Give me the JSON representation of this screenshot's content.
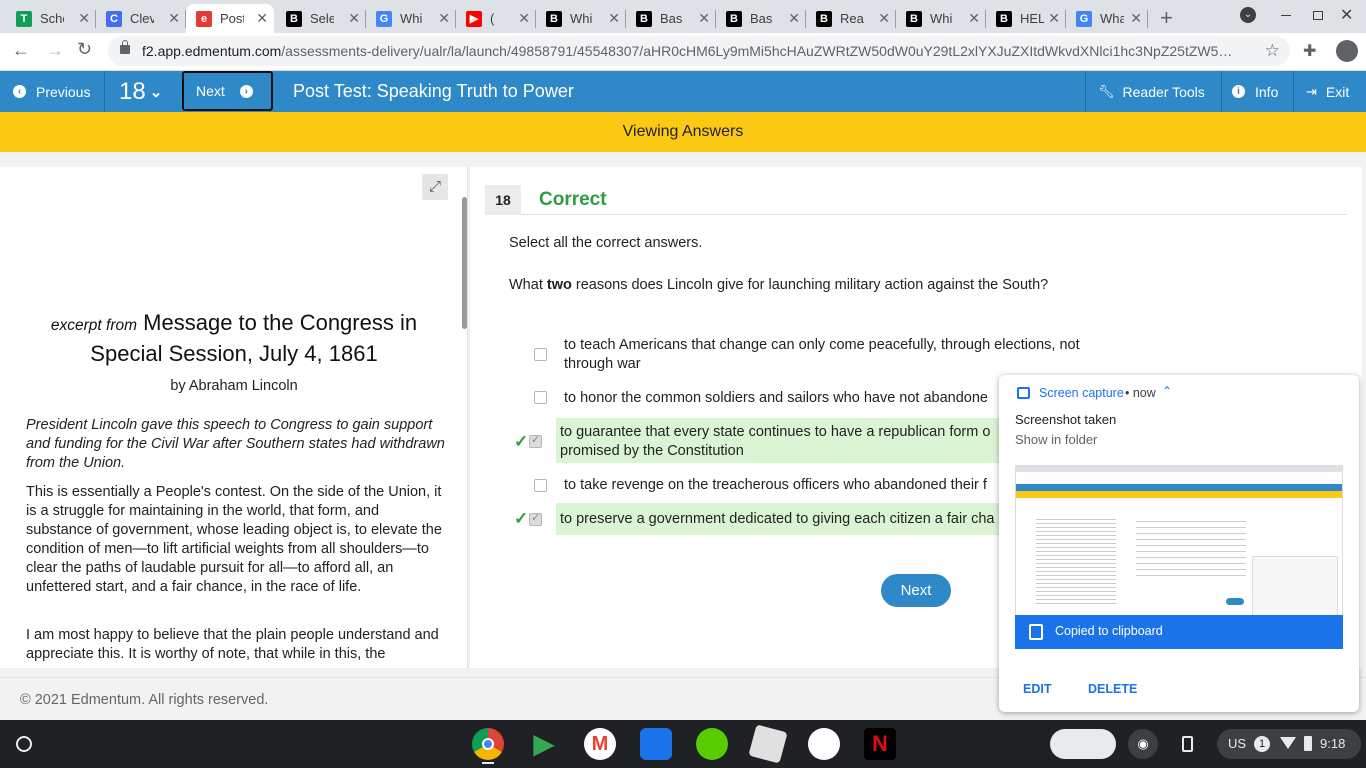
{
  "browser": {
    "tabs": [
      {
        "title": "Sche",
        "icon": "google-sheets-icon",
        "color": "#0f9d58",
        "glyph": "T"
      },
      {
        "title": "Clev",
        "icon": "clever-icon",
        "color": "#436cf2",
        "glyph": "C"
      },
      {
        "title": "Post",
        "icon": "edmentum-icon",
        "color": "#e53935",
        "glyph": "e",
        "active": true
      },
      {
        "title": "Sele",
        "icon": "brainly-icon",
        "color": "#000000",
        "glyph": "B"
      },
      {
        "title": "Whi",
        "icon": "google-icon",
        "color": "#4285f4",
        "glyph": "G"
      },
      {
        "title": "(",
        "icon": "youtube-icon",
        "color": "#ff0000",
        "glyph": "▶"
      },
      {
        "title": "Whi",
        "icon": "brainly-icon",
        "color": "#000000",
        "glyph": "B"
      },
      {
        "title": "Bas",
        "icon": "brainly-icon",
        "color": "#000000",
        "glyph": "B"
      },
      {
        "title": "Bas",
        "icon": "brainly-icon",
        "color": "#000000",
        "glyph": "B"
      },
      {
        "title": "Rea",
        "icon": "brainly-icon",
        "color": "#000000",
        "glyph": "B"
      },
      {
        "title": "Whi",
        "icon": "brainly-icon",
        "color": "#000000",
        "glyph": "B"
      },
      {
        "title": "HEL",
        "icon": "brainly-icon",
        "color": "#000000",
        "glyph": "B"
      },
      {
        "title": "Wha",
        "icon": "google-icon",
        "color": "#4285f4",
        "glyph": "G"
      }
    ],
    "url_host": "f2.app.edmentum.com",
    "url_path": "/assessments-delivery/ualr/la/launch/49858791/45548307/aHR0cHM6Ly9mMi5hcHAuZWRtZW50dW0uY29tL2xlYXJuZXItdWkvdXNlci1hc3NpZ25tZW5…"
  },
  "header": {
    "previous_label": "Previous",
    "question_number": "18",
    "next_label": "Next",
    "title": "Post Test: Speaking Truth to Power",
    "reader_tools_label": "Reader Tools",
    "info_label": "Info",
    "exit_label": "Exit"
  },
  "banner": {
    "text": "Viewing Answers"
  },
  "passage": {
    "excerpt_prefix": "excerpt from",
    "title_line1": "Message to the Congress in",
    "title_line2": "Special Session, July 4, 1861",
    "byline": "by Abraham Lincoln",
    "intro": "President Lincoln gave this speech to Congress to gain support and funding for the Civil War after Southern states had withdrawn from the Union.",
    "para1": "This is essentially a People's contest. On the side of the Union, it is a struggle for maintaining in the world, that form, and substance of government, whose leading object is, to elevate the condition of men—to lift artificial weights from all shoulders—to clear the paths of laudable pursuit for all—to afford all, an unfettered start, and a fair chance, in the race of life.",
    "para2": "I am most happy to believe that the plain people understand and appreciate this. It is worthy of note, that while in this, the"
  },
  "question": {
    "number": "18",
    "status": "Correct",
    "instruction": "Select all the correct answers.",
    "prompt_pre": "What",
    "prompt_bold": "two",
    "prompt_post": "reasons does Lincoln give for launching military action against the South?",
    "options": [
      {
        "text": "to teach Americans that change can only come peacefully, through elections, not through war",
        "checked": false,
        "correct": false
      },
      {
        "text": "to honor the common soldiers and sailors who have not abandone",
        "checked": false,
        "correct": false
      },
      {
        "text": "to guarantee that every state continues to have a republican form o",
        "text2": "promised by the Constitution",
        "checked": true,
        "correct": true
      },
      {
        "text": "to take revenge on the treacherous officers who abandoned their f",
        "checked": false,
        "correct": false
      },
      {
        "text": "to preserve a government dedicated to giving each citizen a fair cha",
        "checked": true,
        "correct": true
      }
    ],
    "next_label": "Next"
  },
  "footer": {
    "copyright": "© 2021 Edmentum. All rights reserved."
  },
  "notification": {
    "source": "Screen capture",
    "time": "• now",
    "title": "Screenshot taken",
    "subtitle": "Show in folder",
    "clipboard_text": "Copied to clipboard",
    "edit_label": "EDIT",
    "delete_label": "DELETE"
  },
  "tray": {
    "locale": "US",
    "notif_count": "1",
    "time": "9:18"
  },
  "colors": {
    "header_blue": "#2f89c9",
    "banner_yellow": "#fcc915",
    "correct_green": "#2e9e3e",
    "correct_bg": "#d9f5d3",
    "clip_blue": "#1a73e8"
  }
}
